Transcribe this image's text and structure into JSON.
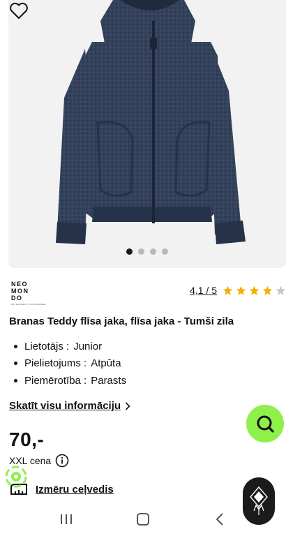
{
  "product": {
    "image_alt_icon": "fleece-jacket-image",
    "carousel": {
      "count": 4,
      "active": 0
    },
    "brand_logo": {
      "lines": [
        "NEO",
        "MON",
        "DO"
      ],
      "tagline": "ALL ELEMENTS CONSIDERED"
    },
    "rating": {
      "score_label": "4,1 / 5",
      "value": 4.1,
      "max": 5
    },
    "title": "Branas Teddy flīsa jaka, flīsa jaka - Tumši zila",
    "specs": [
      {
        "key": "Lietotājs :",
        "value": "Junior"
      },
      {
        "key": "Pielietojums :",
        "value": "Atpūta"
      },
      {
        "key": "Piemērotība :",
        "value": "Parasts"
      }
    ],
    "more_link": "Skatīt visu informāciju",
    "price": "70,-",
    "price_label": "XXL cena",
    "size_guide": "Izmēru ceļvedis"
  },
  "colors": {
    "accent_green": "#8ff04a",
    "jacket_navy": "#2f3c55",
    "star_yellow": "#f2b100",
    "star_empty": "#c7c7c7"
  },
  "navbar": {
    "items": [
      {
        "icon": "recent-apps-icon"
      },
      {
        "icon": "home-icon"
      },
      {
        "icon": "back-icon"
      }
    ]
  }
}
